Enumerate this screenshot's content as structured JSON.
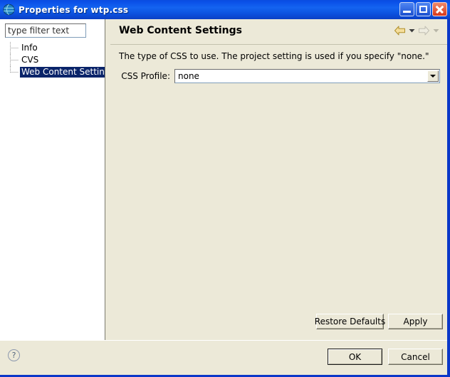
{
  "window": {
    "title": "Properties for wtp.css",
    "icon": "eclipse-globe-icon",
    "controls": {
      "minimize_label": "Minimize",
      "maximize_label": "Maximize",
      "close_label": "Close"
    }
  },
  "sidebar": {
    "filter": {
      "value": "type filter text",
      "placeholder": "type filter text"
    },
    "items": [
      {
        "label": "Info",
        "selected": false
      },
      {
        "label": "CVS",
        "selected": false
      },
      {
        "label": "Web Content Settings",
        "selected": true
      }
    ]
  },
  "page": {
    "title": "Web Content Settings",
    "description": "The type of CSS to use.  The project setting is used if you specify \"none.\"",
    "nav": {
      "back_icon": "back-arrow-icon",
      "back_menu_icon": "chevron-down-icon",
      "forward_icon": "forward-arrow-icon",
      "forward_menu_icon": "chevron-down-icon"
    },
    "fields": [
      {
        "label": "CSS Profile:",
        "value": "none",
        "dropdown_icon": "chevron-down-icon"
      }
    ],
    "buttons": {
      "restore_defaults": "Restore Defaults",
      "apply": "Apply"
    }
  },
  "footer": {
    "help_icon": "question-mark-icon",
    "ok": "OK",
    "cancel": "Cancel"
  },
  "colors": {
    "titlebar_blue": "#1464f0",
    "window_border_blue": "#0a37c8",
    "panel_beige": "#ece9d8",
    "tree_panel_white": "#ffffff",
    "selection_blue": "#0a246a",
    "close_red": "#d8381a",
    "nav_arrow_yellow": "#e8c96a"
  }
}
